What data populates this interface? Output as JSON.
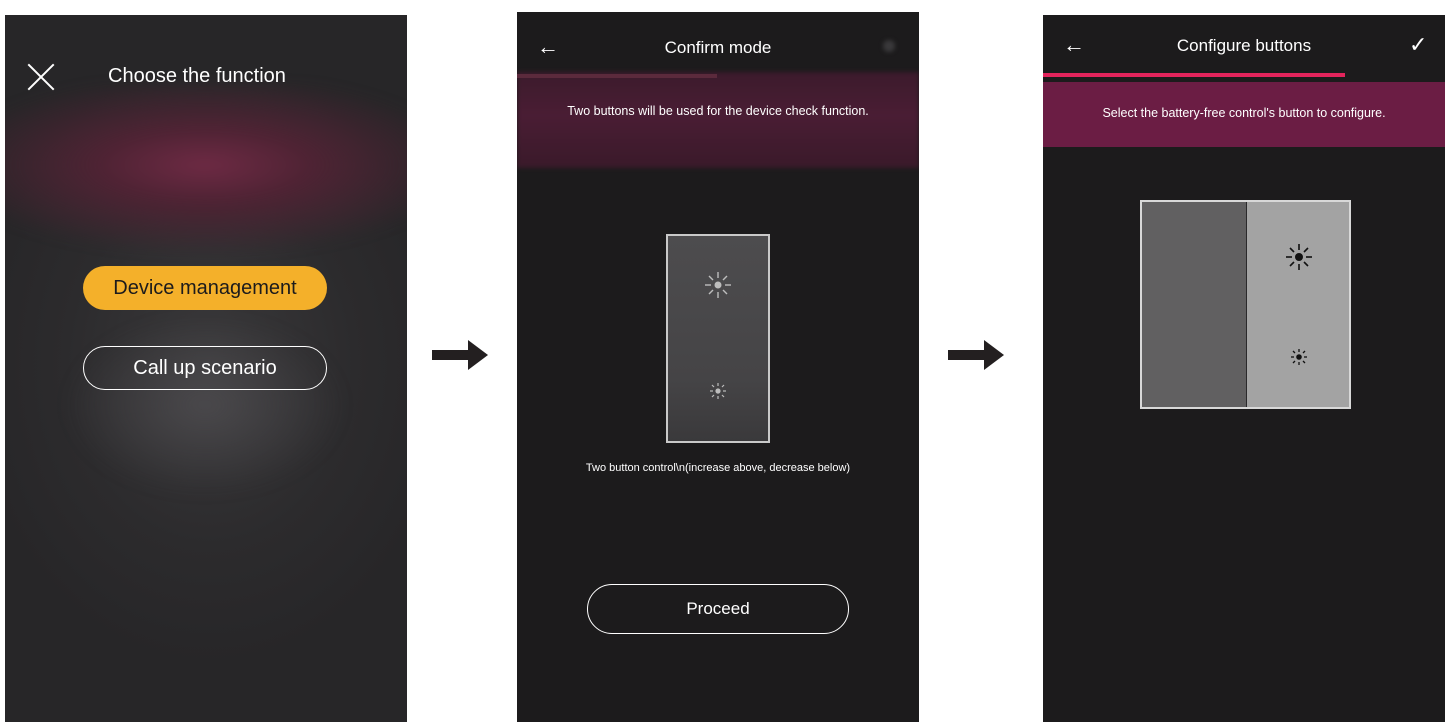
{
  "screen1": {
    "title": "Choose the function",
    "close_icon": "close-icon",
    "options": [
      {
        "label": "Device management",
        "selected": true
      },
      {
        "label": "Call up scenario",
        "selected": false
      }
    ],
    "colors": {
      "selected_option": "#f4b02a",
      "background": "#2c2b2d",
      "accent_glow": "#6e2a44"
    }
  },
  "arrows": [
    "arrow-right-icon",
    "arrow-right-icon"
  ],
  "screen2": {
    "title": "Confirm mode",
    "back_icon": "arrow-left-icon",
    "message": "Two buttons will be used for the device check function.",
    "device_label": "Two button control\\n(increase above, decrease below)",
    "device_icons": [
      "brightness-up-icon",
      "brightness-down-icon"
    ],
    "proceed_label": "Proceed"
  },
  "screen3": {
    "title": "Configure buttons",
    "back_icon": "arrow-left-icon",
    "confirm_icon": "checkmark-icon",
    "message": "Select the battery-free control's button to configure.",
    "device_icons": [
      "brightness-up-icon",
      "brightness-down-icon"
    ],
    "colors": {
      "progress": "#e3245c",
      "banner": "#6b1d44"
    }
  }
}
